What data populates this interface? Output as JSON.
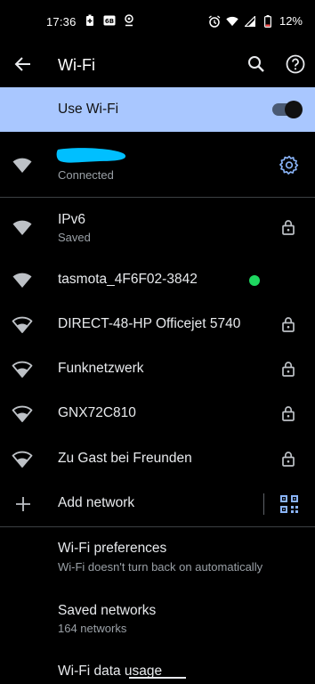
{
  "status_bar": {
    "time": "17:36",
    "battery_percent": "12%",
    "icons_left": [
      "battery-saver-icon",
      "storage-6b-icon",
      "location-pin-icon"
    ],
    "icons_right": [
      "alarm-icon",
      "wifi-signal-icon",
      "cell-signal-icon",
      "battery-low-icon"
    ]
  },
  "app_bar": {
    "title": "Wi-Fi",
    "back_icon": "arrow-back-icon",
    "search_icon": "search-icon",
    "help_icon": "help-icon"
  },
  "use_wifi": {
    "label": "Use Wi-Fi",
    "enabled": true
  },
  "connected_network": {
    "status": "Connected",
    "name_redacted": true
  },
  "networks": [
    {
      "ssid": "IPv6",
      "status": "Saved",
      "locked": true
    },
    {
      "ssid": "tasmota_4F6F02-3842",
      "locked": false,
      "indicator_color": "#1ed760"
    },
    {
      "ssid": "DIRECT-48-HP Officejet 5740",
      "locked": true
    },
    {
      "ssid": "Funknetzwerk",
      "locked": true
    },
    {
      "ssid": "GNX72C810",
      "locked": true
    },
    {
      "ssid": "Zu Gast bei Freunden",
      "locked": true
    }
  ],
  "add_network": {
    "label": "Add network",
    "qr_icon": "qr-scan-icon"
  },
  "settings": {
    "preferences_title": "Wi-Fi preferences",
    "preferences_subtitle": "Wi-Fi doesn't turn back on automatically",
    "saved_title": "Saved networks",
    "saved_subtitle": "164 networks",
    "usage_title": "Wi-Fi data usage"
  },
  "colors": {
    "background": "#000000",
    "accent_bar": "#a9c7ff",
    "accent_icon": "#8ab4f8",
    "redaction": "#00bfff",
    "text_primary": "#e8eaed",
    "text_secondary": "#9aa0a6"
  }
}
